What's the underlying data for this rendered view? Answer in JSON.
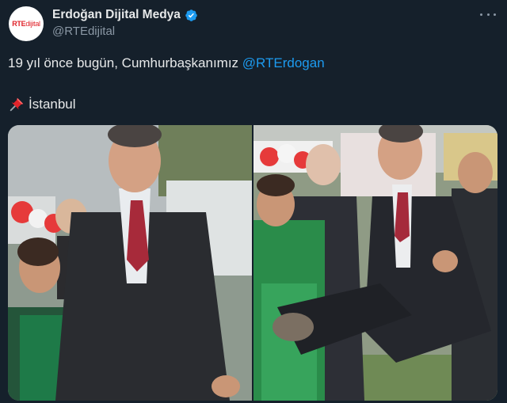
{
  "account": {
    "display_name": "Erdoğan Dijital Medya",
    "handle": "@RTEdijital",
    "avatar_logo": "RTE",
    "avatar_logo_suffix": "dijital",
    "verified": true
  },
  "tweet": {
    "text": "19 yıl önce bugün, Cumhurbaşkanımız ",
    "mention": "@RTErdogan",
    "location": "İstanbul"
  },
  "icons": {
    "verified": "verified-badge-icon",
    "more": "more-options-icon",
    "pin": "pushpin-icon"
  },
  "colors": {
    "background": "#15202b",
    "link": "#1d9bf0",
    "secondary_text": "#8b98a5"
  },
  "media": {
    "photos": [
      {
        "label": "photo-1"
      },
      {
        "label": "photo-2"
      }
    ]
  }
}
